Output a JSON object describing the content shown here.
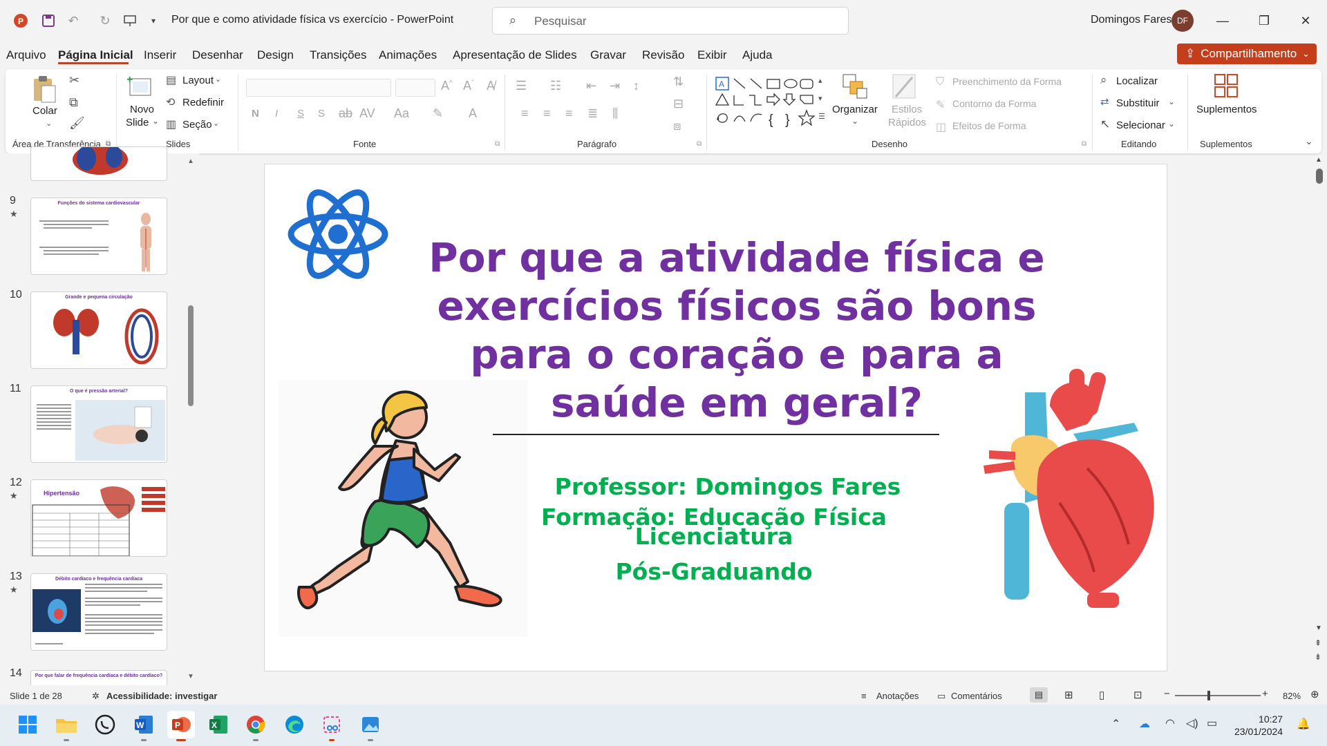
{
  "titlebar": {
    "doc_title": "Por que e como atividade física vs exercício  -  PowerPoint",
    "search_placeholder": "Pesquisar",
    "user_name": "Domingos Fares",
    "user_initials": "DF"
  },
  "menu": {
    "tabs": [
      "Arquivo",
      "Página Inicial",
      "Inserir",
      "Desenhar",
      "Design",
      "Transições",
      "Animações",
      "Apresentação de Slides",
      "Gravar",
      "Revisão",
      "Exibir",
      "Ajuda"
    ],
    "active_tab": "Página Inicial",
    "share_label": "Compartilhamento"
  },
  "ribbon": {
    "clipboard": {
      "paste": "Colar",
      "label": "Área de Transferência"
    },
    "slides": {
      "new_slide_1": "Novo",
      "new_slide_2": "Slide",
      "layout": "Layout",
      "reset": "Redefinir",
      "section": "Seção",
      "label": "Slides"
    },
    "font": {
      "bold": "N",
      "italic": "I",
      "underline": "S",
      "shadow": "S",
      "label": "Fonte"
    },
    "paragraph": {
      "label": "Parágrafo"
    },
    "drawing": {
      "arrange": "Organizar",
      "quick_styles_1": "Estilos",
      "quick_styles_2": "Rápidos",
      "shape_fill": "Preenchimento da Forma",
      "shape_outline": "Contorno da Forma",
      "shape_effects": "Efeitos de Forma",
      "label": "Desenho"
    },
    "editing": {
      "find": "Localizar",
      "replace": "Substituir",
      "select": "Selecionar",
      "label": "Editando"
    },
    "addins": {
      "addins": "Suplementos",
      "label": "Suplementos"
    }
  },
  "thumbnails": [
    {
      "num": "9",
      "star": true,
      "title": "Funções do sistema cardiovascular"
    },
    {
      "num": "10",
      "star": false,
      "title": "Grande e pequena circulação"
    },
    {
      "num": "11",
      "star": false,
      "title": "O que é pressão arterial?"
    },
    {
      "num": "12",
      "star": true,
      "title": "Hipertensão"
    },
    {
      "num": "13",
      "star": true,
      "title": "Débito cardíaco e frequência cardíaca"
    },
    {
      "num": "14",
      "star": false,
      "title": "Por que falar de frequência cardíaca e débito cardíaco?"
    }
  ],
  "slide": {
    "title_lines": [
      "Por que a atividade física e",
      "exercícios físicos são bons",
      "para o coração e para a",
      "saúde em geral?"
    ],
    "professor": "Professor: Domingos Fares",
    "formation_1": "Formação: Educação Física",
    "formation_2": "Licenciatura",
    "postgrad": "Pós-Graduando"
  },
  "statusbar": {
    "slide_counter": "Slide 1 de 28",
    "accessibility": "Acessibilidade: investigar",
    "notes": "Anotações",
    "comments": "Comentários",
    "zoom": "82%"
  },
  "taskbar": {
    "time": "10:27",
    "date": "23/01/2024"
  },
  "colors": {
    "title_purple": "#7030a0",
    "subtitle_green": "#00b050",
    "share_orange": "#c43e1c",
    "atom_blue": "#1f6fd1"
  }
}
